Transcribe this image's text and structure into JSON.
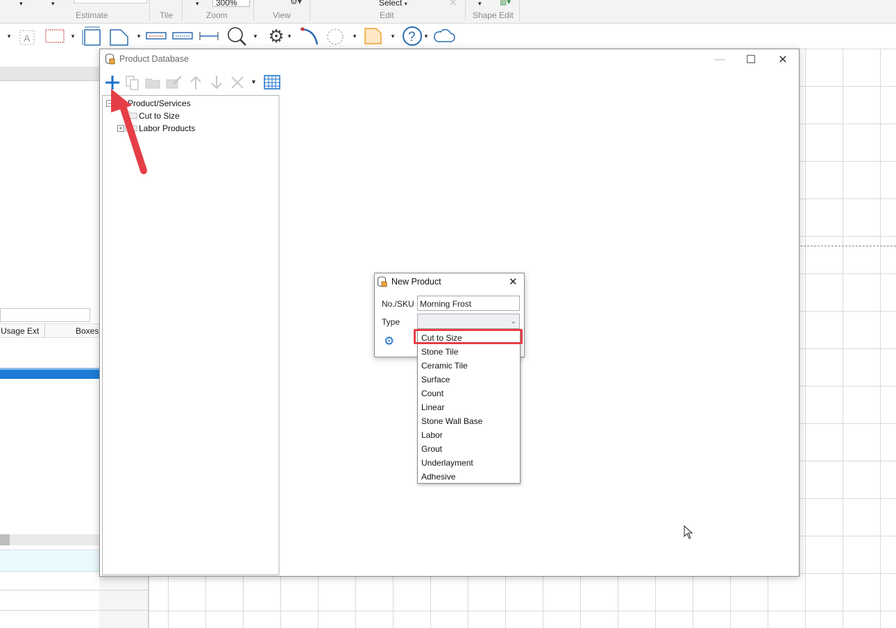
{
  "ribbon": {
    "zoom_value": "300%",
    "select_label": "Select",
    "groups": {
      "estimate": "Estimate",
      "tile": "Tile",
      "zoom": "Zoom",
      "view": "View",
      "edit": "Edit",
      "shape_edit": "Shape Edit"
    }
  },
  "toolbar_icons": [
    "text-icon",
    "rectangle-icon",
    "resize-icon",
    "shape-icon",
    "dimension-icon",
    "dimension2-icon",
    "measure-icon",
    "zoom-icon",
    "settings-icon",
    "arc-icon",
    "rotate-icon",
    "page-icon",
    "help-icon",
    "cloud-icon"
  ],
  "left_pane": {
    "col_usage_ext": "Usage Ext",
    "col_boxes": "Boxes"
  },
  "product_database": {
    "title": "Product Database",
    "toolbar_icons": [
      "add-icon",
      "copy-icon",
      "open-folder-icon",
      "edit-icon",
      "move-up-icon",
      "move-down-icon",
      "delete-icon",
      "grid-icon"
    ],
    "tree": {
      "root": "Product/Services",
      "children": [
        "Cut to Size",
        "Labor Products"
      ]
    }
  },
  "new_product": {
    "title": "New Product",
    "sku_label": "No./SKU",
    "sku_value": "Morning Frost",
    "type_label": "Type",
    "type_value": ""
  },
  "type_options": [
    "Cut to Size",
    "Stone Tile",
    "Ceramic Tile",
    "Surface",
    "Count",
    "Linear",
    "Stone Wall Base",
    "Labor",
    "Grout",
    "Underlayment",
    "Adhesive"
  ],
  "highlighted_option": "Cut to Size",
  "colors": {
    "accent": "#1a6fc9",
    "annotation": "#e53e46",
    "selection_bar": "#1c7cd6"
  }
}
